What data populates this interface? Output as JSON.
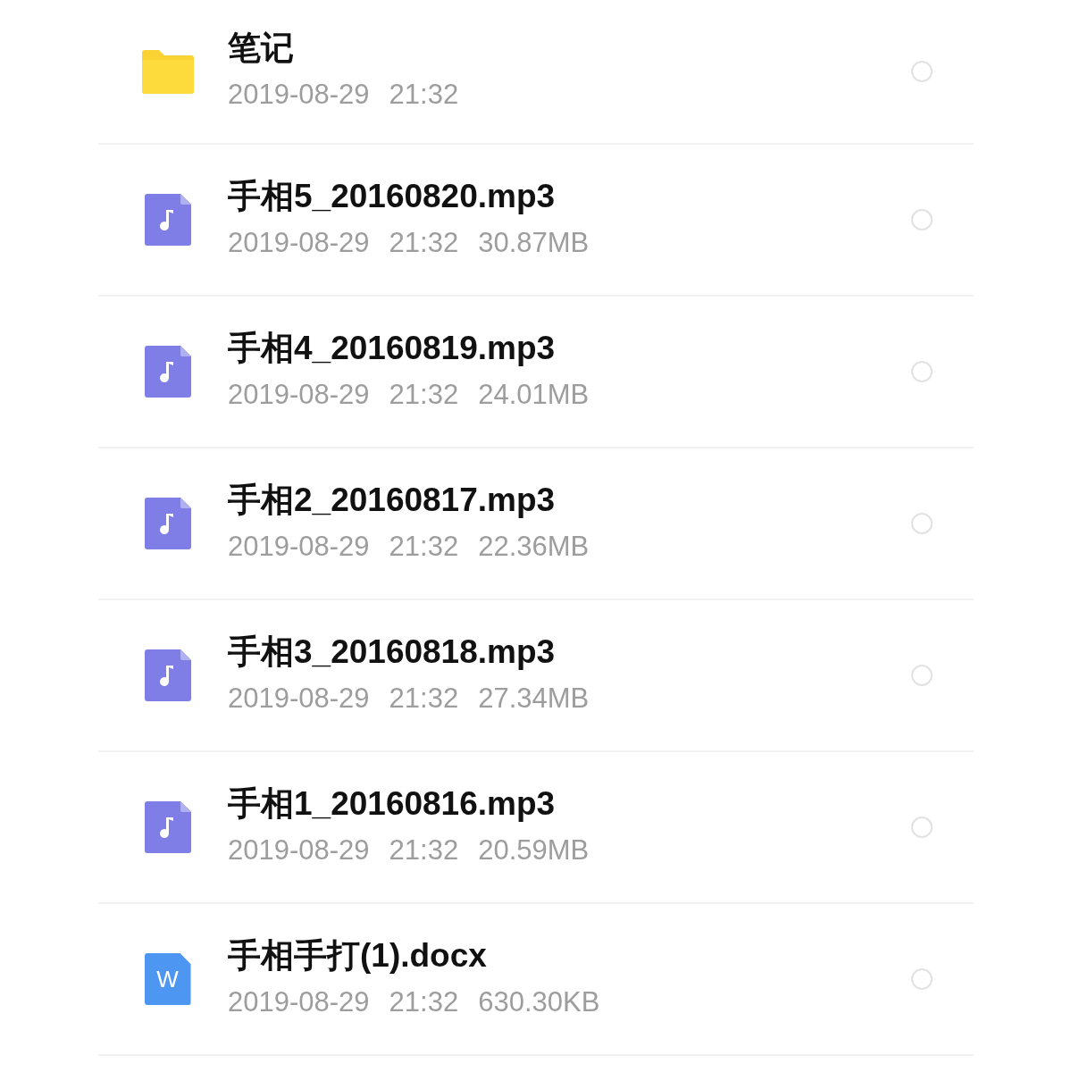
{
  "files": [
    {
      "kind": "folder",
      "name": "笔记",
      "meta": [
        "2019-08-29",
        "21:32"
      ],
      "selected": false
    },
    {
      "kind": "audio",
      "name": "手相5_20160820.mp3",
      "meta": [
        "2019-08-29",
        "21:32",
        "30.87MB"
      ],
      "selected": false
    },
    {
      "kind": "audio",
      "name": "手相4_20160819.mp3",
      "meta": [
        "2019-08-29",
        "21:32",
        "24.01MB"
      ],
      "selected": false
    },
    {
      "kind": "audio",
      "name": "手相2_20160817.mp3",
      "meta": [
        "2019-08-29",
        "21:32",
        "22.36MB"
      ],
      "selected": false
    },
    {
      "kind": "audio",
      "name": "手相3_20160818.mp3",
      "meta": [
        "2019-08-29",
        "21:32",
        "27.34MB"
      ],
      "selected": false
    },
    {
      "kind": "audio",
      "name": "手相1_20160816.mp3",
      "meta": [
        "2019-08-29",
        "21:32",
        "20.59MB"
      ],
      "selected": false
    },
    {
      "kind": "word",
      "name": "手相手打(1).docx",
      "meta": [
        "2019-08-29",
        "21:32",
        "630.30KB"
      ],
      "selected": false,
      "badge": "W"
    }
  ]
}
